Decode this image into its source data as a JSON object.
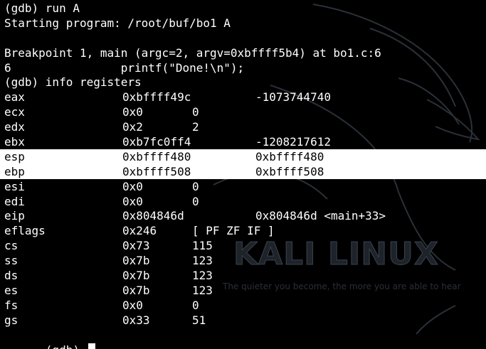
{
  "terminal": {
    "lines": [
      {
        "text": "(gdb) run A"
      },
      {
        "text": "Starting program: /root/buf/bo1 A"
      },
      {
        "text": ""
      },
      {
        "text": "Breakpoint 1, main (argc=2, argv=0xbffff5b4) at bo1.c:6"
      },
      {
        "text": "6                printf(\"Done!\\n\");"
      },
      {
        "text": "(gdb) info registers"
      }
    ],
    "registers": [
      {
        "name": "eax",
        "hex": "0xbffff49c",
        "value": "-1073744740"
      },
      {
        "name": "ecx",
        "hex": "0x0",
        "value": "0"
      },
      {
        "name": "edx",
        "hex": "0x2",
        "value": "2"
      },
      {
        "name": "ebx",
        "hex": "0xb7fc0ff4",
        "value": "-1208217612"
      },
      {
        "name": "esp",
        "hex": "0xbffff480",
        "value": "0xbffff480"
      },
      {
        "name": "ebp",
        "hex": "0xbffff508",
        "value": "0xbffff508"
      },
      {
        "name": "esi",
        "hex": "0x0",
        "value": "0"
      },
      {
        "name": "edi",
        "hex": "0x0",
        "value": "0"
      },
      {
        "name": "eip",
        "hex": "0x804846d",
        "value": "0x804846d <main+33>"
      },
      {
        "name": "eflags",
        "hex": "0x246",
        "value": "[ PF ZF IF ]"
      },
      {
        "name": "cs",
        "hex": "0x73",
        "value": "115"
      },
      {
        "name": "ss",
        "hex": "0x7b",
        "value": "123"
      },
      {
        "name": "ds",
        "hex": "0x7b",
        "value": "123"
      },
      {
        "name": "es",
        "hex": "0x7b",
        "value": "123"
      },
      {
        "name": "fs",
        "hex": "0x0",
        "value": "0"
      },
      {
        "name": "gs",
        "hex": "0x33",
        "value": "51"
      }
    ],
    "prompt": "(gdb) "
  },
  "wallpaper": {
    "logo": "KALI LINUX",
    "tagline": "The quieter you become, the more you are able to hear"
  },
  "colors": {
    "background": "#000000",
    "text": "#ffffff",
    "highlight": "#ffffff"
  }
}
